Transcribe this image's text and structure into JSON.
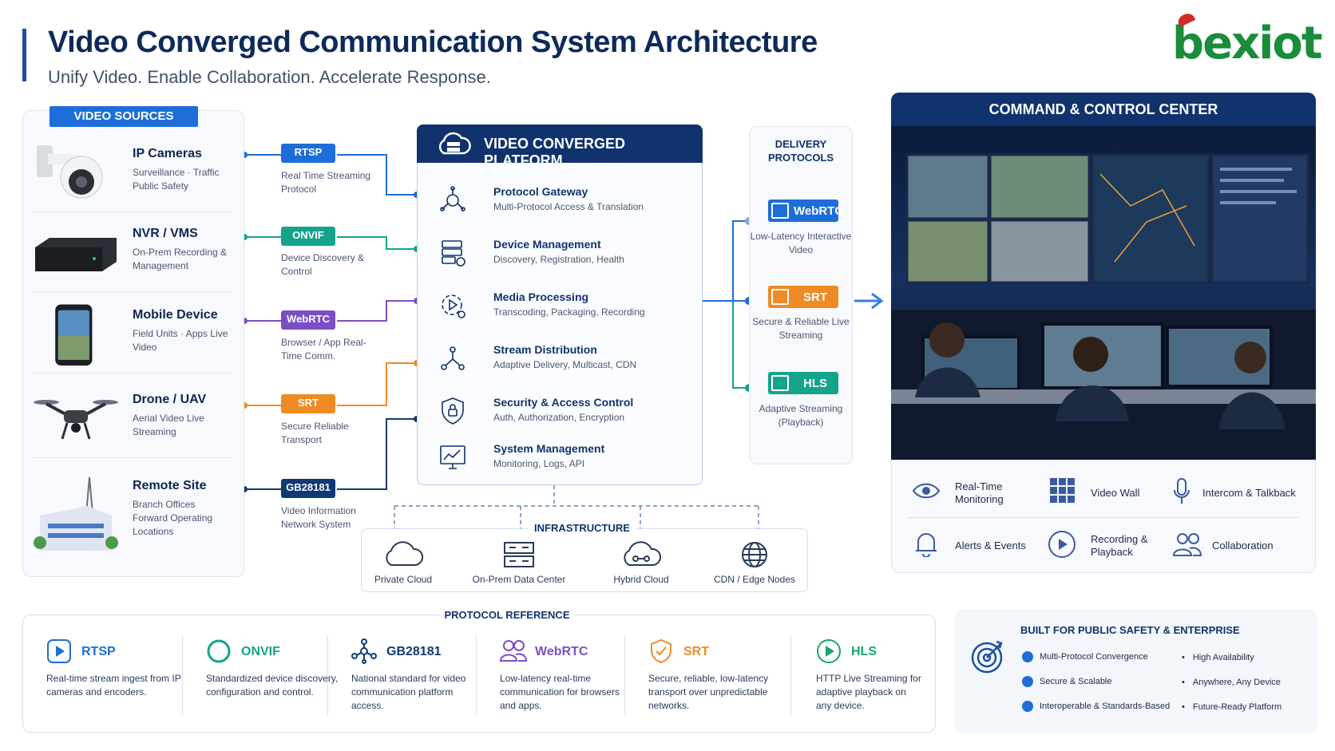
{
  "header": {
    "title": "Video Converged Communication System Architecture",
    "subtitle": "Unify Video. Enable Collaboration. Accelerate Response.",
    "logo_text": "bexiot"
  },
  "colors": {
    "navy": "#10336e",
    "blue": "#1d6ed8",
    "teal": "#14a38b",
    "purple": "#7b4fc4",
    "orange": "#f08a24",
    "green": "#1aa56a",
    "darkblue": "#0f3a74"
  },
  "video_sources": {
    "heading": "VIDEO SOURCES",
    "items": [
      {
        "name": "IP Cameras",
        "desc": "Surveillance · Traffic Public Safety",
        "icon": "ip-camera-icon"
      },
      {
        "name": "NVR / VMS",
        "desc": "On-Prem Recording & Management",
        "icon": "nvr-icon"
      },
      {
        "name": "Mobile Device",
        "desc": "Field Units · Apps Live Video",
        "icon": "mobile-device-icon"
      },
      {
        "name": "Drone / UAV",
        "desc": "Aerial Video Live Streaming",
        "icon": "drone-icon"
      },
      {
        "name": "Remote Site",
        "desc": "Branch Offices Forward Operating Locations",
        "icon": "remote-site-icon"
      }
    ]
  },
  "ingest_protocols": [
    {
      "label": "RTSP",
      "desc": "Real Time Streaming Protocol"
    },
    {
      "label": "ONVIF",
      "desc": "Device Discovery & Control"
    },
    {
      "label": "WebRTC",
      "desc": "Browser / App Real-Time Comm."
    },
    {
      "label": "SRT",
      "desc": "Secure Reliable Transport"
    },
    {
      "label": "GB28181",
      "desc": "Video Information Network System"
    }
  ],
  "platform": {
    "heading": "VIDEO CONVERGED PLATFORM",
    "items": [
      {
        "name": "Protocol Gateway",
        "desc": "Multi-Protocol Access & Translation",
        "icon": "gateway-icon"
      },
      {
        "name": "Device Management",
        "desc": "Discovery, Registration, Health",
        "icon": "server-icon"
      },
      {
        "name": "Media Processing",
        "desc": "Transcoding, Packaging, Recording",
        "icon": "gear-play-icon"
      },
      {
        "name": "Stream Distribution",
        "desc": "Adaptive Delivery, Multicast, CDN",
        "icon": "network-icon"
      },
      {
        "name": "Security & Access Control",
        "desc": "Auth, Authorization, Encryption",
        "icon": "shield-lock-icon"
      },
      {
        "name": "System Management",
        "desc": "Monitoring, Logs, API",
        "icon": "monitor-chart-icon"
      }
    ]
  },
  "delivery": {
    "heading_line1": "DELIVERY",
    "heading_line2": "PROTOCOLS",
    "items": [
      {
        "label": "WebRTC",
        "desc": "Low-Latency Interactive Video"
      },
      {
        "label": "SRT",
        "desc": "Secure & Reliable Live Streaming"
      },
      {
        "label": "HLS",
        "desc": "Adaptive Streaming (Playback)"
      }
    ]
  },
  "command_center": {
    "heading": "COMMAND & CONTROL CENTER",
    "features": [
      {
        "label": "Real-Time Monitoring",
        "icon": "eye-icon"
      },
      {
        "label": "Video Wall",
        "icon": "grid-icon"
      },
      {
        "label": "Intercom & Talkback",
        "icon": "microphone-icon"
      },
      {
        "label": "Alerts & Events",
        "icon": "bell-icon"
      },
      {
        "label": "Recording & Playback",
        "icon": "play-circle-icon"
      },
      {
        "label": "Collaboration",
        "icon": "users-icon"
      }
    ]
  },
  "infrastructure": {
    "heading": "INFRASTRUCTURE",
    "items": [
      {
        "label": "Private Cloud",
        "icon": "cloud-icon"
      },
      {
        "label": "On-Prem Data Center",
        "icon": "datacenter-icon"
      },
      {
        "label": "Hybrid Cloud",
        "icon": "hybrid-cloud-icon"
      },
      {
        "label": "CDN / Edge Nodes",
        "icon": "globe-icon"
      }
    ]
  },
  "protocol_reference": {
    "heading": "PROTOCOL REFERENCE",
    "items": [
      {
        "name": "RTSP",
        "desc": "Real-time stream ingest from IP cameras and encoders.",
        "icon": "play-square-icon"
      },
      {
        "name": "ONVIF",
        "desc": "Standardized device discovery, configuration and control.",
        "icon": "ring-icon"
      },
      {
        "name": "GB28181",
        "desc": "National standard for video communication platform access.",
        "icon": "nodes-icon"
      },
      {
        "name": "WebRTC",
        "desc": "Low-latency real-time communication for browsers and apps.",
        "icon": "people-icon"
      },
      {
        "name": "SRT",
        "desc": "Secure, reliable, low-latency transport over unpredictable networks.",
        "icon": "shield-check-icon"
      },
      {
        "name": "HLS",
        "desc": "HTTP Live Streaming for adaptive playback on any device.",
        "icon": "play-circle-icon"
      }
    ]
  },
  "built_for": {
    "heading": "BUILT FOR PUBLIC SAFETY & ENTERPRISE",
    "checks": [
      "Multi-Protocol Convergence",
      "Secure & Scalable",
      "Interoperable & Standards-Based"
    ],
    "bullets": [
      "High Availability",
      "Anywhere, Any Device",
      "Future-Ready Platform"
    ]
  }
}
